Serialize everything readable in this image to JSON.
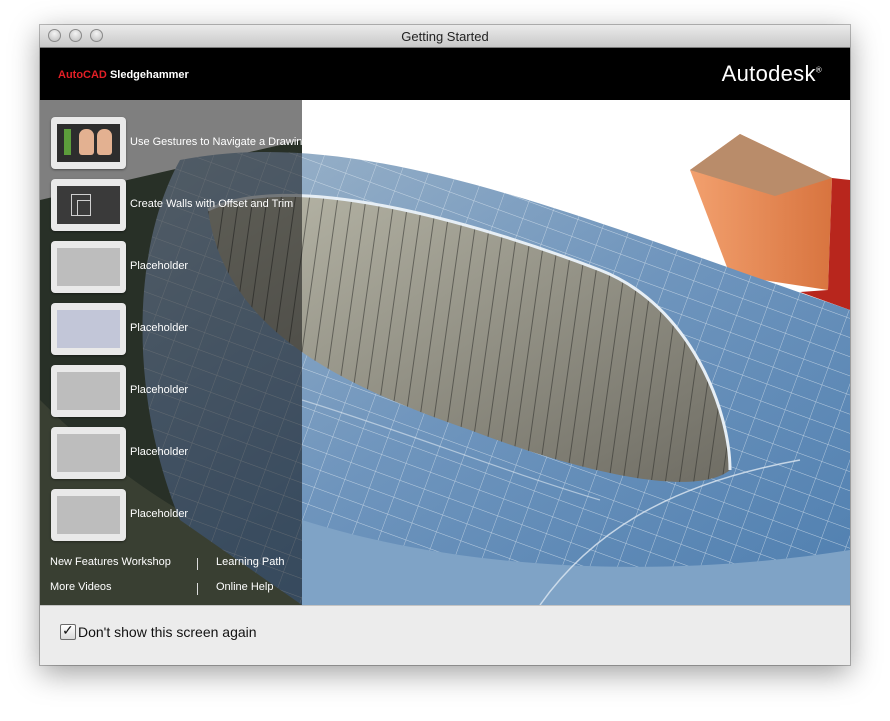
{
  "window": {
    "title": "Getting Started"
  },
  "brand": {
    "product_prefix": "AutoCAD",
    "product_name": " Sledgehammer",
    "company": "Autodesk",
    "company_mark": "®"
  },
  "colors": {
    "brand_red": "#e21f26",
    "header_bg": "#000000"
  },
  "tutorials": [
    {
      "label": "Use Gestures to Navigate a Drawing",
      "icon": "gesture-hands-icon"
    },
    {
      "label": "Create Walls with Offset and Trim",
      "icon": "walls-offset-icon"
    },
    {
      "label": "Placeholder",
      "icon": "placeholder-icon"
    },
    {
      "label": "Placeholder",
      "icon": "placeholder-icon"
    },
    {
      "label": "Placeholder",
      "icon": "placeholder-icon"
    },
    {
      "label": "Placeholder",
      "icon": "placeholder-icon"
    },
    {
      "label": "Placeholder",
      "icon": "placeholder-icon"
    }
  ],
  "links": {
    "new_features": "New Features Workshop",
    "learning_path": "Learning Path",
    "more_videos": "More Videos",
    "online_help": "Online Help"
  },
  "footer": {
    "dont_show_label": "Don't show this screen again",
    "dont_show_checked": true
  }
}
